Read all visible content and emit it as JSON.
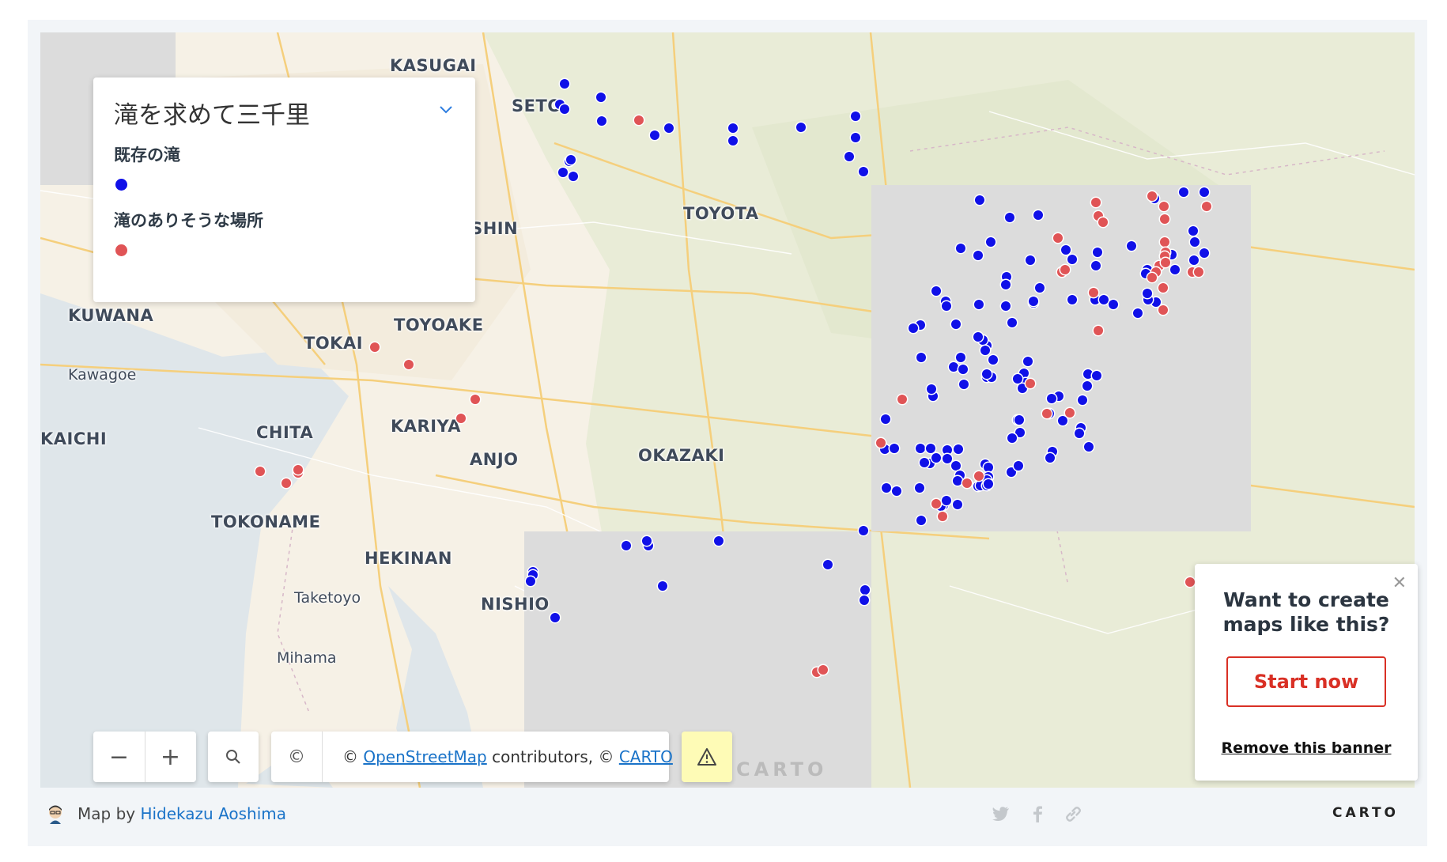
{
  "map": {
    "cities": [
      {
        "id": "kasugai",
        "name": "KASUGAI"
      },
      {
        "id": "seto",
        "name": "SETO"
      },
      {
        "id": "toyota",
        "name": "TOYOTA"
      },
      {
        "id": "nisshin",
        "name": "NISSHIN"
      },
      {
        "id": "kuwana",
        "name": "KUWANA"
      },
      {
        "id": "toyoake",
        "name": "TOYOAKE"
      },
      {
        "id": "tokai",
        "name": "TOKAI"
      },
      {
        "id": "kawagoe",
        "name": "Kawagoe"
      },
      {
        "id": "chita",
        "name": "CHITA"
      },
      {
        "id": "kariya",
        "name": "KARIYA"
      },
      {
        "id": "kaichi",
        "name": "KAICHI"
      },
      {
        "id": "anjo",
        "name": "ANJO"
      },
      {
        "id": "okazaki",
        "name": "OKAZAKI"
      },
      {
        "id": "tokoname",
        "name": "TOKONAME"
      },
      {
        "id": "hekinan",
        "name": "HEKINAN"
      },
      {
        "id": "taketoyo",
        "name": "Taketoyo"
      },
      {
        "id": "nishio",
        "name": "NISHIO"
      },
      {
        "id": "mihama",
        "name": "Mihama"
      }
    ]
  },
  "legend": {
    "title": "滝を求めて三千里",
    "items": [
      {
        "label": "既存の滝",
        "color": "#1010e8"
      },
      {
        "label": "滝のありそうな場所",
        "color": "#e05456"
      }
    ]
  },
  "controls": {
    "zoom_out": "−",
    "zoom_in": "+",
    "attribution_icon": "©",
    "attribution_prefix": "© ",
    "attribution_osm": "OpenStreetMap",
    "attribution_mid": " contributors, © ",
    "attribution_carto": "CARTO",
    "watermark": "CARTO"
  },
  "banner": {
    "title_line1": "Want to create",
    "title_line2": "maps like this?",
    "button": "Start now",
    "remove": "Remove this banner"
  },
  "footer": {
    "author_prefix": "Map by ",
    "author_name": "Hidekazu Aoshima",
    "logo": "CARTO"
  },
  "icons": {
    "legend_toggle": "chevron-down-icon",
    "search": "search-icon",
    "attribution": "copyright-icon",
    "warning": "warning-icon",
    "close": "close-icon",
    "twitter": "twitter-icon",
    "facebook": "facebook-icon",
    "link": "link-icon"
  }
}
